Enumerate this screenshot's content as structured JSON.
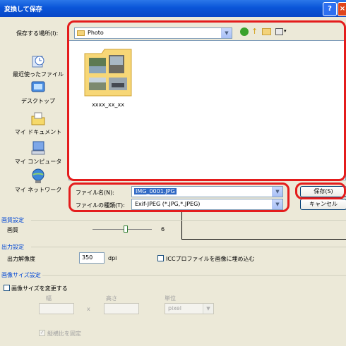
{
  "window": {
    "title": "変換して保存",
    "help_label": "?",
    "close_label": "×"
  },
  "location": {
    "label": "保存する場所(I):",
    "folder": "Photo"
  },
  "places": [
    {
      "label": "最近使ったファイル",
      "icon": "recent-files-icon"
    },
    {
      "label": "デスクトップ",
      "icon": "desktop-icon"
    },
    {
      "label": "マイ ドキュメント",
      "icon": "my-documents-icon"
    },
    {
      "label": "マイ コンピュータ",
      "icon": "my-computer-icon"
    },
    {
      "label": "マイ ネットワーク",
      "icon": "my-network-icon"
    }
  ],
  "files": [
    {
      "name": "xxxx_xx_xx",
      "icon": "folder-thumbnail-icon"
    }
  ],
  "filename": {
    "label": "ファイル名(N):",
    "value": "IMG_0001.JPG"
  },
  "filetype": {
    "label": "ファイルの種類(T):",
    "value": "Exif-JPEG (*.JPG,*.JPEG)"
  },
  "buttons": {
    "save": "保存(S)",
    "cancel": "キャンセル"
  },
  "quality": {
    "section": "画質設定",
    "label": "画質",
    "value": "6",
    "level_fraction": 0.5
  },
  "output": {
    "section": "出力設定",
    "resolution_label": "出力解像度",
    "resolution_value": "350",
    "resolution_unit": "dpi",
    "icc_label": "ICCプロファイルを画像に埋め込む"
  },
  "size": {
    "section": "画像サイズ設定",
    "change_label": "画像サイズを変更する",
    "width_label": "幅",
    "height_label": "高さ",
    "x_label": "x",
    "unit_label": "単位",
    "unit_value": "pixel",
    "ratio_label": "縦横比を固定"
  },
  "colors": {
    "highlight": "#e41c1c",
    "section_text": "#0046d5",
    "titlebar": "#0a55d8"
  }
}
